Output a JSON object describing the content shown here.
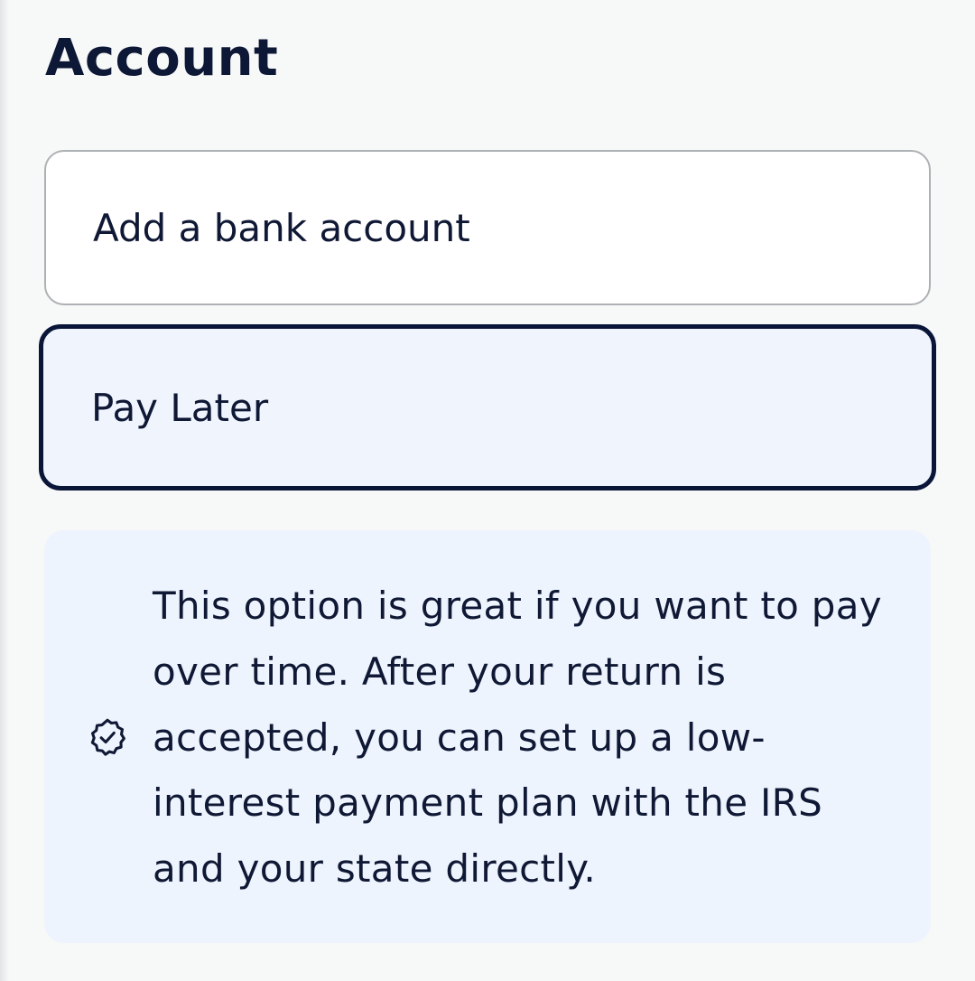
{
  "header": {
    "title": "Account"
  },
  "options": [
    {
      "label": "Add a bank account",
      "selected": false
    },
    {
      "label": "Pay Later",
      "selected": true
    }
  ],
  "info": {
    "icon": "verified-badge-icon",
    "text": "This option is great if you want to pay over time. After your return is accepted, you can set up a low-interest payment plan with the IRS and your state directly."
  },
  "colors": {
    "text": "#0f1834",
    "selected_border": "#0a1638",
    "selected_background": "#eff4fd",
    "info_background": "#eef4fd",
    "unselected_border": "#aeb1b4"
  }
}
